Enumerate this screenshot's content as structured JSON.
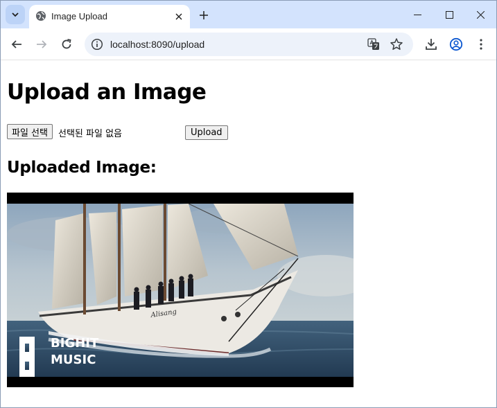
{
  "browser": {
    "tab": {
      "title": "Image Upload"
    },
    "omnibox": {
      "url": "localhost:8090/upload"
    }
  },
  "page": {
    "heading": "Upload an Image",
    "file_input": {
      "button_label": "파일 선택",
      "status": "선택된 파일 없음"
    },
    "upload_button": "Upload",
    "uploaded_heading": "Uploaded Image:",
    "image": {
      "description_icon": "sailing-ship-photo",
      "watermark_line1": "BIGHIT",
      "watermark_line2": "MUSIC",
      "hull_name": "Alisang"
    }
  },
  "colors": {
    "tabstrip": "#d3e3fd",
    "omnibox": "#edf2fa",
    "accent": "#0b57d0"
  }
}
